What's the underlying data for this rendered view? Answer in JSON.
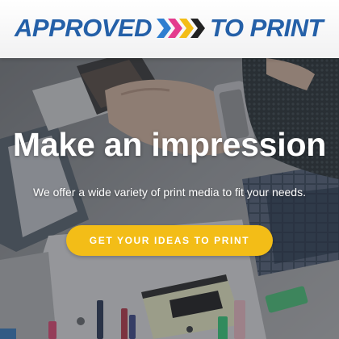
{
  "brand": {
    "left": "APPROVED",
    "right": "TO PRINT",
    "color": "#2460a8",
    "chevron_colors": [
      "#2f7fd0",
      "#e43c8e",
      "#f3bd17",
      "#222222"
    ]
  },
  "hero": {
    "headline": "Make an impression",
    "subtext": "We offer a wide variety of print media to fit your needs.",
    "cta_label": "GET YOUR IDEAS TO PRINT",
    "cta_color": "#f3bd17"
  }
}
